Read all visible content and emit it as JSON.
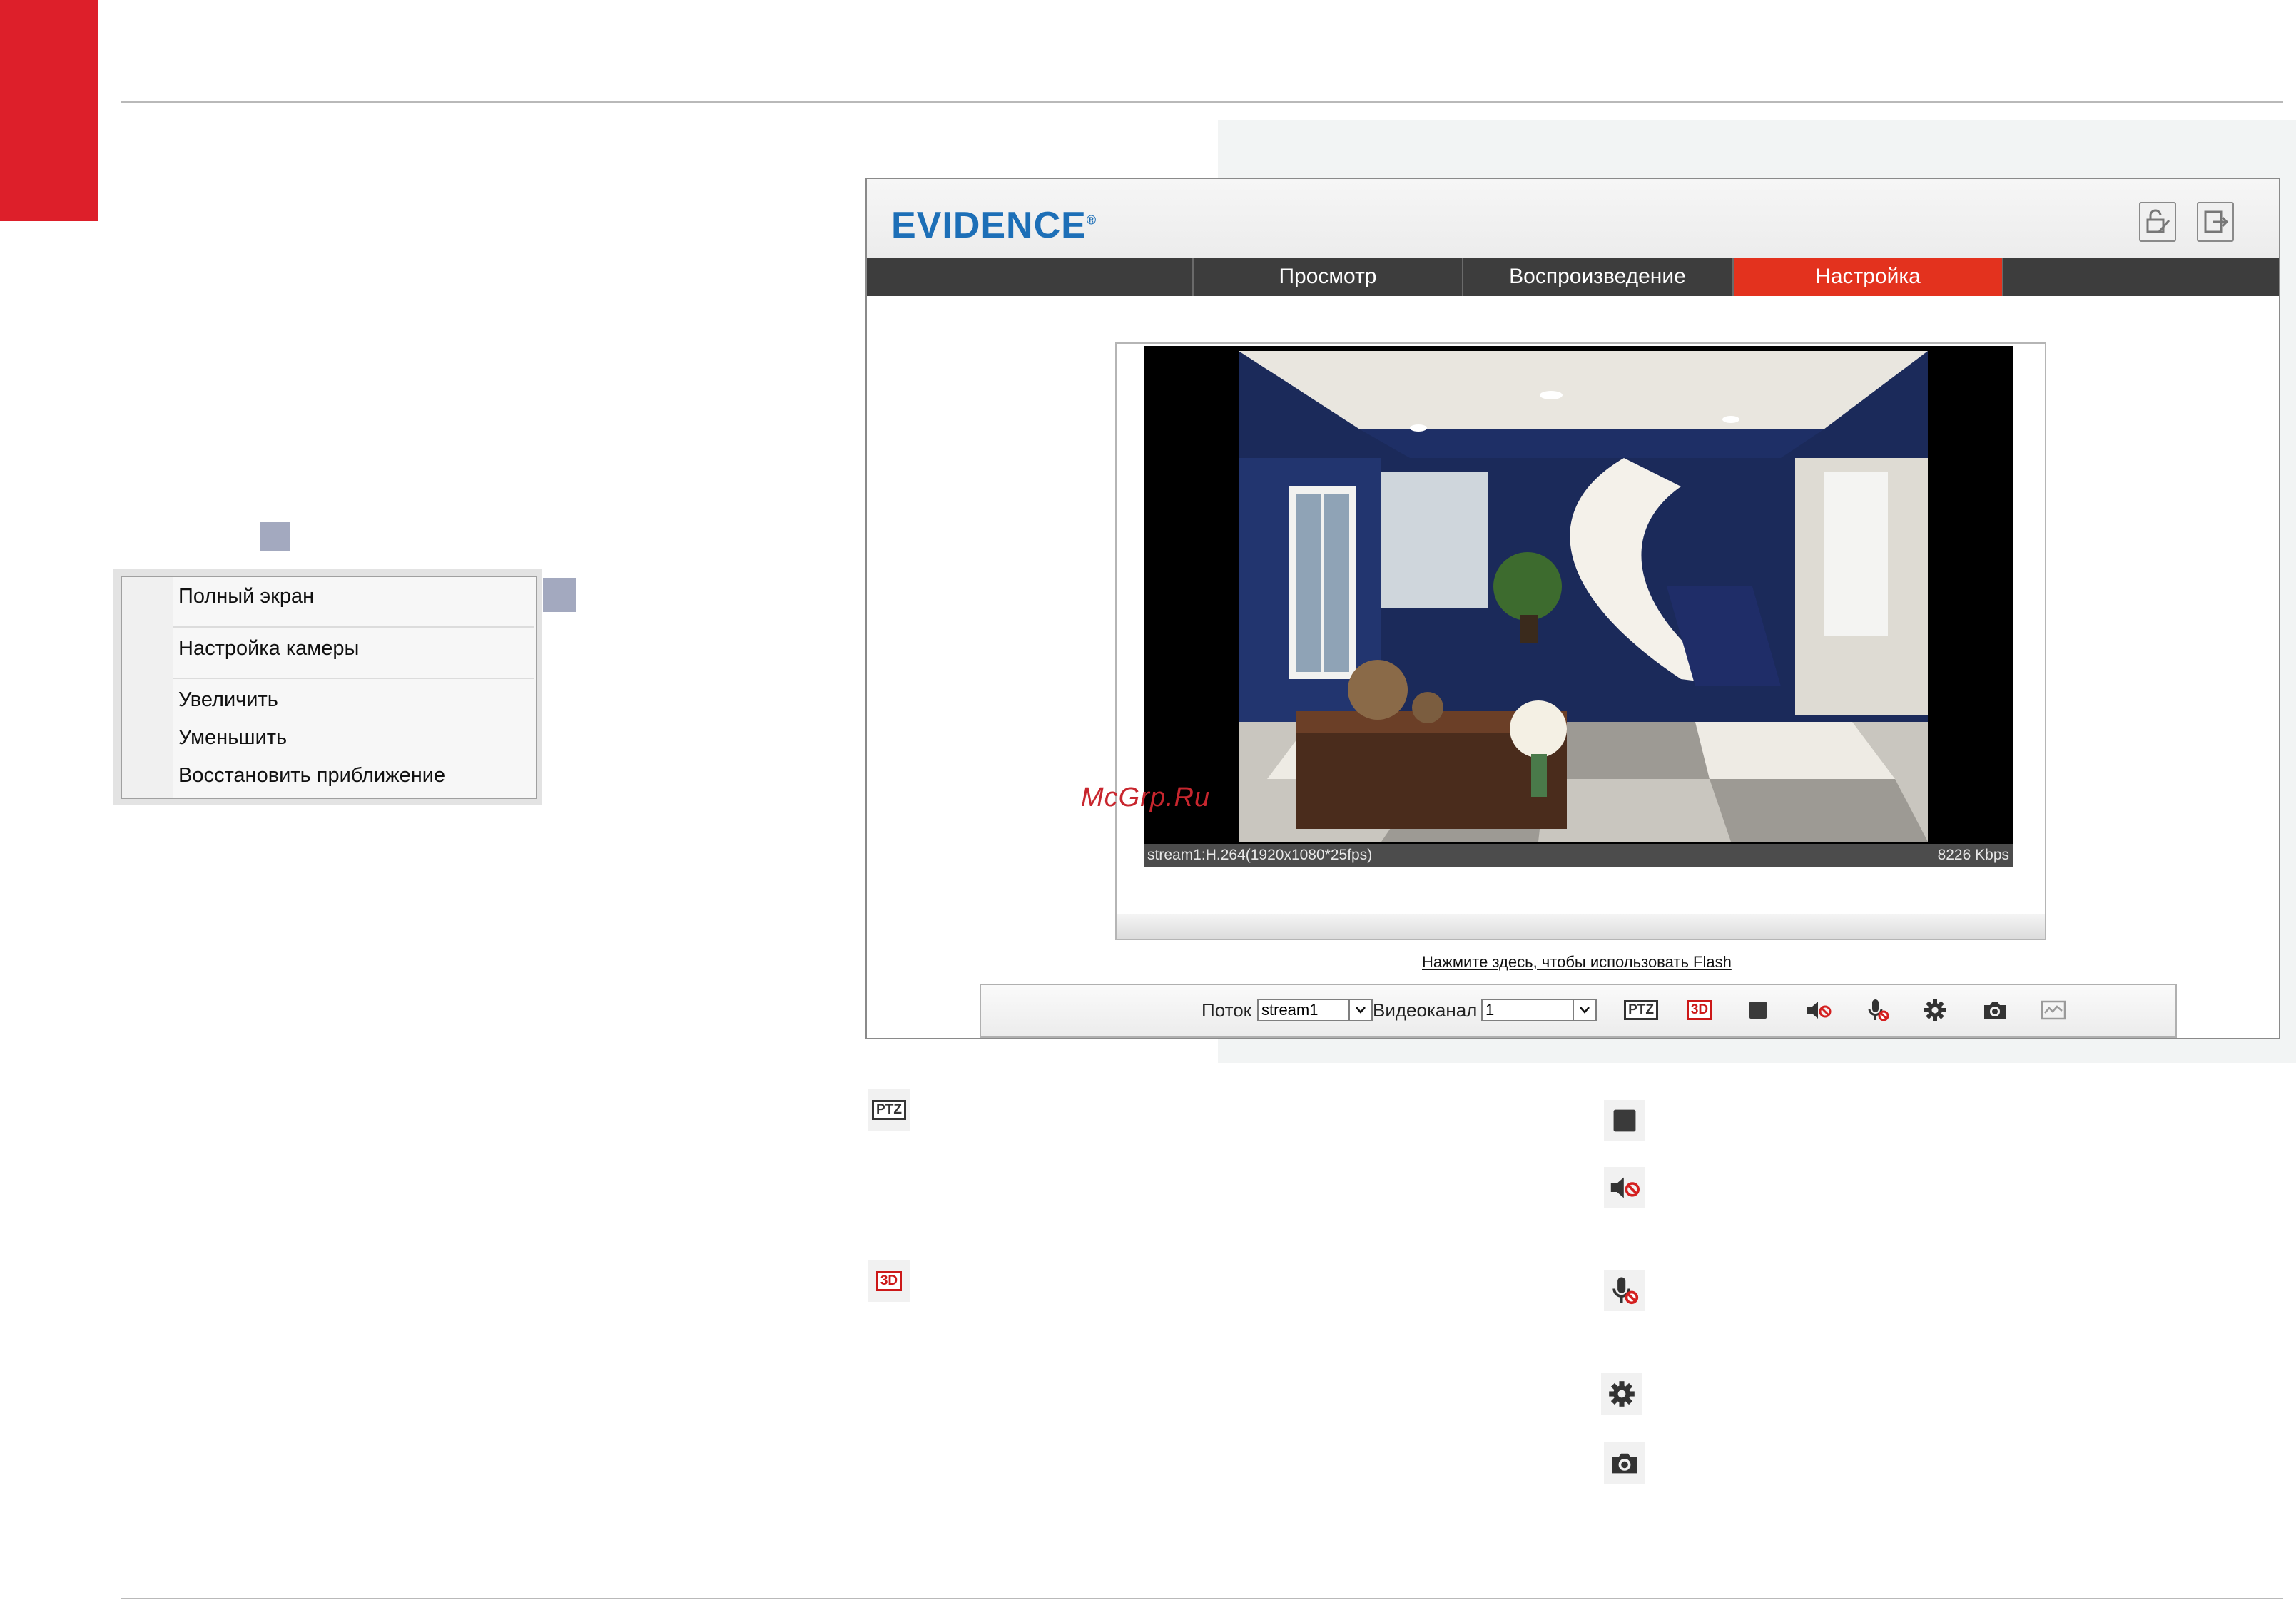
{
  "app": {
    "logo": "EVIDENCE",
    "logo_mark": "®"
  },
  "nav": {
    "tabs": [
      {
        "label": "Просмотр",
        "active": false
      },
      {
        "label": "Воспроизведение",
        "active": false
      },
      {
        "label": "Настройка",
        "active": true
      }
    ]
  },
  "context_menu": {
    "items": [
      "Полный экран",
      "Настройка камеры",
      "Увеличить",
      "Уменьшить",
      "Восстановить приближение"
    ]
  },
  "player": {
    "status_left": "stream1:H.264(1920x1080*25fps)",
    "status_right": "8226 Kbps",
    "flash_link": "Нажмите здесь, чтобы использовать Flash"
  },
  "toolbar": {
    "stream_label": "Поток",
    "stream_value": "stream1",
    "channel_label": "Видеоканал",
    "channel_value": "1",
    "ptz_label": "PTZ",
    "three_d_label": "3D"
  },
  "legend": {
    "ptz_label": "PTZ",
    "three_d_label": "3D"
  },
  "watermark": "McGrp.Ru",
  "colors": {
    "accent_red": "#dd1f2a",
    "active_tab": "#e3321e",
    "logo_blue": "#1d6fb7",
    "navbar": "#3d3d3d"
  },
  "icons": [
    "lock-edit-icon",
    "logout-icon",
    "chevron-down-icon",
    "ptz-icon",
    "3d-icon",
    "stop-icon",
    "sound-muted-icon",
    "mic-muted-icon",
    "settings-gear-icon",
    "camera-snapshot-icon",
    "motion-icon"
  ]
}
